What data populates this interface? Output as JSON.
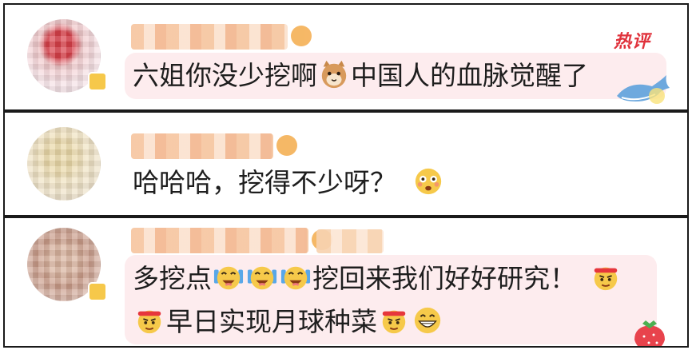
{
  "comments": [
    {
      "username": "",
      "hot_label": "热评",
      "text_before": "六姐你没少挖啊",
      "emoji_mid": "cat-face-icon",
      "text_after": "中国人的血脉觉醒了",
      "sticker": "whale-icon"
    },
    {
      "username": "",
      "text": "哈哈哈，挖得不少呀？",
      "emoji_end": "flushed-face-icon"
    },
    {
      "username": "",
      "line1_a": "多挖点",
      "line1_emojis": [
        "cheering-face-icon",
        "cheering-face-icon",
        "cheering-face-icon"
      ],
      "line1_b": "挖回来我们好好研究！",
      "line1_end": "determined-face-icon",
      "line2_start": "determined-face-icon",
      "line2_text": "早日实现月球种菜",
      "line2_emojis": [
        "determined-face-icon",
        "grinning-face-icon"
      ],
      "sticker": "strawberry-icon"
    }
  ],
  "colors": {
    "hot_label": "#e0323c",
    "bubble": "#fdecee",
    "border": "#1a1a1a"
  }
}
